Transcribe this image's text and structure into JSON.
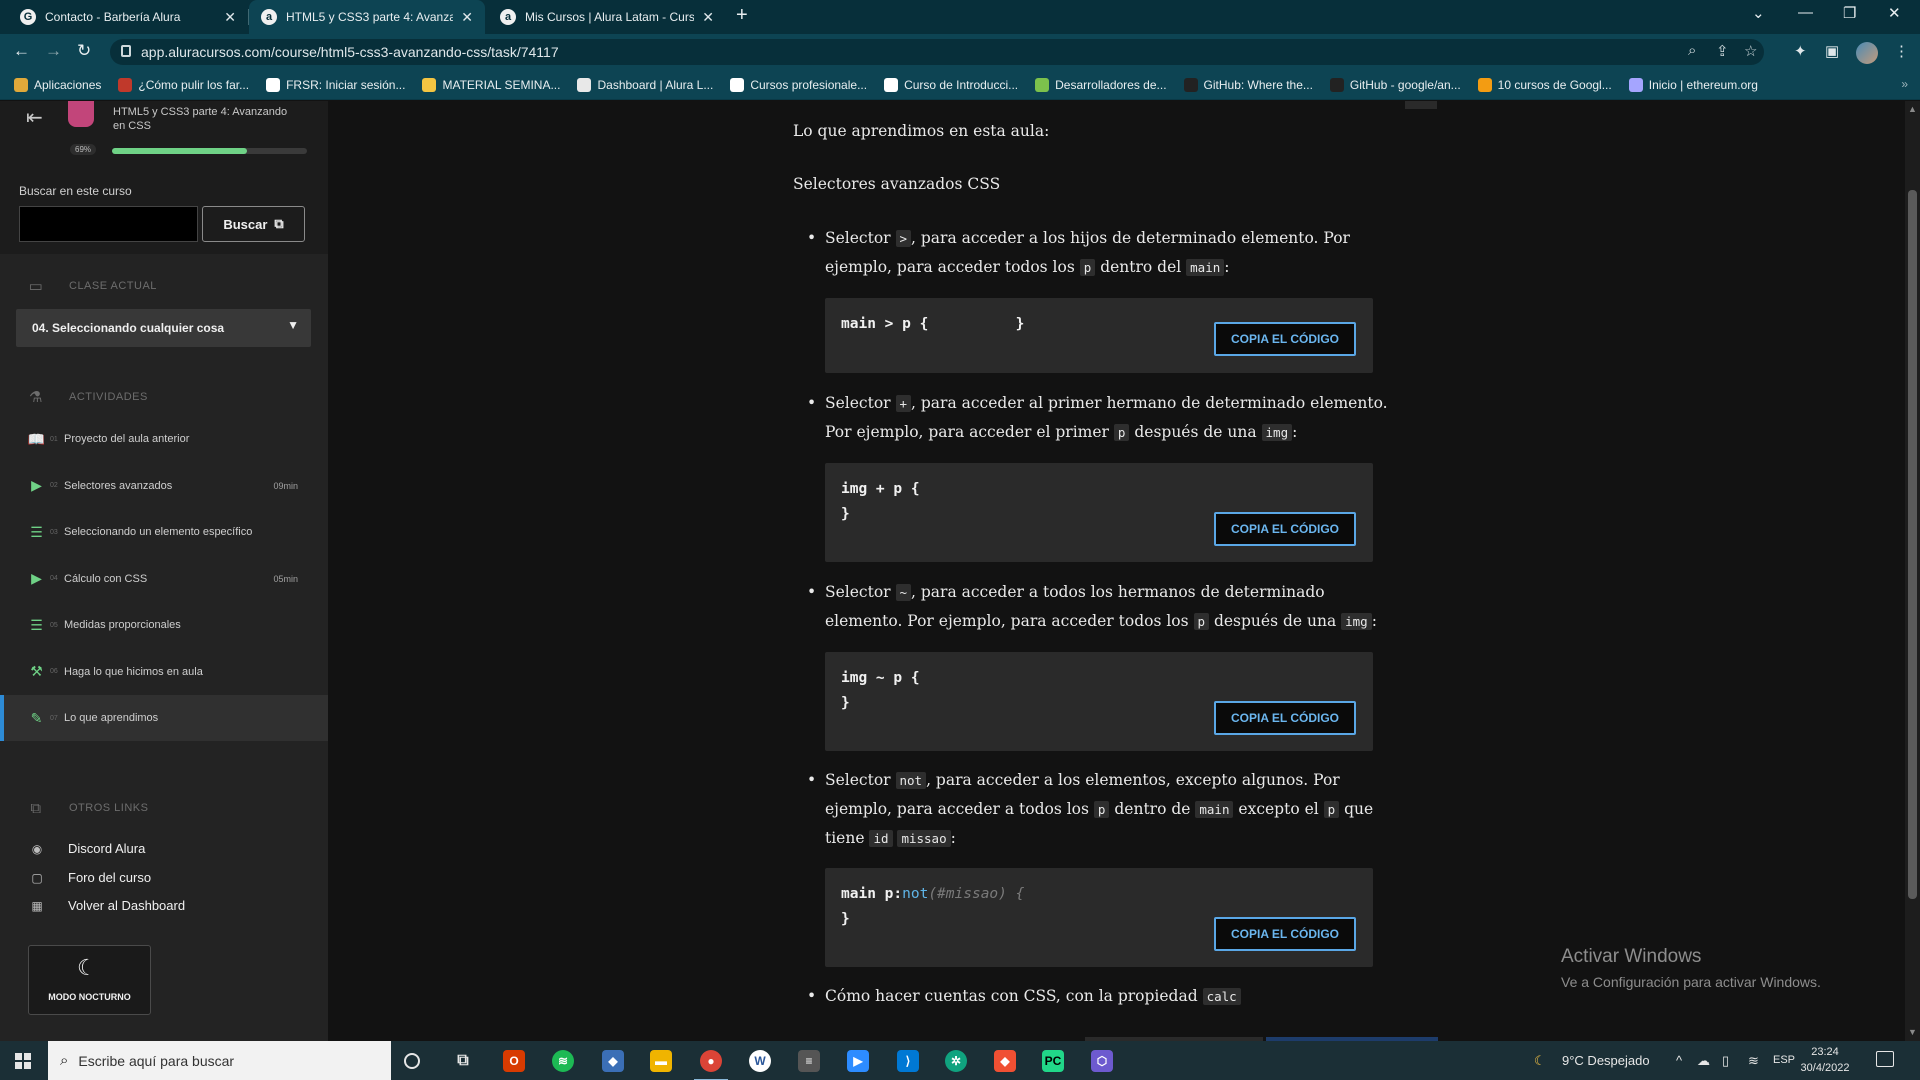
{
  "browser": {
    "tabs": [
      {
        "label": "Contacto - Barbería Alura",
        "favicon": "G",
        "active": false
      },
      {
        "label": "HTML5 y CSS3 parte 4: Avanzando",
        "favicon": "a",
        "active": true
      },
      {
        "label": "Mis Cursos | Alura Latam - Cursos",
        "favicon": "a",
        "active": false
      }
    ],
    "url": "app.aluracursos.com/course/html5-css3-avanzando-css/task/74117",
    "bookmarks": [
      {
        "label": "Aplicaciones",
        "color": "#e0a93a"
      },
      {
        "label": "¿Cómo pulir los far...",
        "color": "#c0392b"
      },
      {
        "label": "FRSR: Iniciar sesión...",
        "color": "#ffffff"
      },
      {
        "label": "MATERIAL SEMINA...",
        "color": "#f4c542"
      },
      {
        "label": "Dashboard | Alura L...",
        "color": "#e8e8e8"
      },
      {
        "label": "Cursos profesionale...",
        "color": "#ffffff"
      },
      {
        "label": "Curso de Introducci...",
        "color": "#ffffff"
      },
      {
        "label": "Desarrolladores de...",
        "color": "#7cc14c"
      },
      {
        "label": "GitHub: Where the...",
        "color": "#222222"
      },
      {
        "label": "GitHub - google/an...",
        "color": "#222222"
      },
      {
        "label": "10 cursos de Googl...",
        "color": "#f39c12"
      },
      {
        "label": "Inicio | ethereum.org",
        "color": "#a5a5ff"
      }
    ],
    "more": "»"
  },
  "sidebar": {
    "course_title": "HTML5 y CSS3 parte 4: Avanzando en CSS",
    "progress_label": "69%",
    "progress": 0.69,
    "search_label": "Buscar en este curso",
    "search_value": "",
    "search_button": "Buscar",
    "current_class_heading": "CLASE ACTUAL",
    "current_lesson": "04. Seleccionando cualquier cosa",
    "activities_heading": "ACTIVIDADES",
    "activities": [
      {
        "num": "01",
        "label": "Proyecto del aula anterior",
        "duration": "",
        "icon": "book-icon",
        "glyph": "📖"
      },
      {
        "num": "02",
        "label": "Selectores avanzados",
        "duration": "09min",
        "icon": "video-icon",
        "glyph": "▶"
      },
      {
        "num": "03",
        "label": "Seleccionando un elemento específico",
        "duration": "",
        "icon": "list-icon",
        "glyph": "☰"
      },
      {
        "num": "04",
        "label": "Cálculo con CSS",
        "duration": "05min",
        "icon": "video-icon",
        "glyph": "▶"
      },
      {
        "num": "05",
        "label": "Medidas proporcionales",
        "duration": "",
        "icon": "list-icon",
        "glyph": "☰"
      },
      {
        "num": "06",
        "label": "Haga lo que hicimos en aula",
        "duration": "",
        "icon": "practice-icon",
        "glyph": "⚒"
      },
      {
        "num": "07",
        "label": "Lo que aprendimos",
        "duration": "",
        "icon": "summary-icon",
        "glyph": "✎"
      }
    ],
    "other_links_heading": "OTROS LINKS",
    "links": [
      {
        "label": "Discord Alura",
        "icon": "discord-icon"
      },
      {
        "label": "Foro del curso",
        "icon": "forum-icon"
      },
      {
        "label": "Volver al Dashboard",
        "icon": "dashboard-icon"
      }
    ],
    "night_mode": "MODO NOCTURNO"
  },
  "main": {
    "heading": "Lo que aprendimos en esta aula:",
    "subheading": "Selectores avanzados CSS",
    "copy_label": "COPIA EL CÓDIGO",
    "b1": {
      "t1": "Selector ",
      "c1": ">",
      "t2": ", para acceder a los hijos de determinado elemento. Por ejemplo, para acceder todos los ",
      "c2": "p",
      "t3": " dentro del ",
      "c3": "main",
      "t4": ":"
    },
    "code1": {
      "l1": "main > p {          }"
    },
    "b2": {
      "t1": "Selector ",
      "c1": "+",
      "t2": ", para acceder al primer hermano de determinado elemento. Por ejemplo, para acceder el primer ",
      "c2": "p",
      "t3": " después de una ",
      "c3": "img",
      "t4": ":"
    },
    "code2": {
      "l1": "img + p {",
      "l2": "}"
    },
    "b3": {
      "t1": "Selector ",
      "c1": "~",
      "t2": ", para acceder a todos los hermanos de determinado elemento. Por ejemplo, para acceder todos los ",
      "c2": "p",
      "t3": " después de una ",
      "c3": "img",
      "t4": ":"
    },
    "code3": {
      "l1": "img ~ p {",
      "l2": "}"
    },
    "b4": {
      "t1": "Selector ",
      "c1": "not",
      "t2": ", para acceder a los elementos, excepto algunos. Por ejemplo, para acceder a todos los ",
      "c2": "p",
      "t3": " dentro de ",
      "c3": "main",
      "t4": " excepto el ",
      "c4": "p",
      "t5": " que tiene ",
      "c5": "id",
      "t6": " ",
      "c6": "missao",
      "t7": ":"
    },
    "code4": {
      "a": "main p:",
      "kw": "not",
      "b": "(",
      "cm": "#missao",
      "c": ") {",
      "l2": "}"
    },
    "b5": {
      "t1": "Cómo hacer cuentas con CSS, con la propiedad ",
      "c1": "calc"
    }
  },
  "watermark": {
    "title": "Activar Windows",
    "subtitle": "Ve a Configuración para activar Windows."
  },
  "taskbar": {
    "search_placeholder": "Escribe aquí para buscar",
    "weather": "9°C  Despejado",
    "lang": "ESP",
    "time": "23:24",
    "date": "30/4/2022"
  }
}
